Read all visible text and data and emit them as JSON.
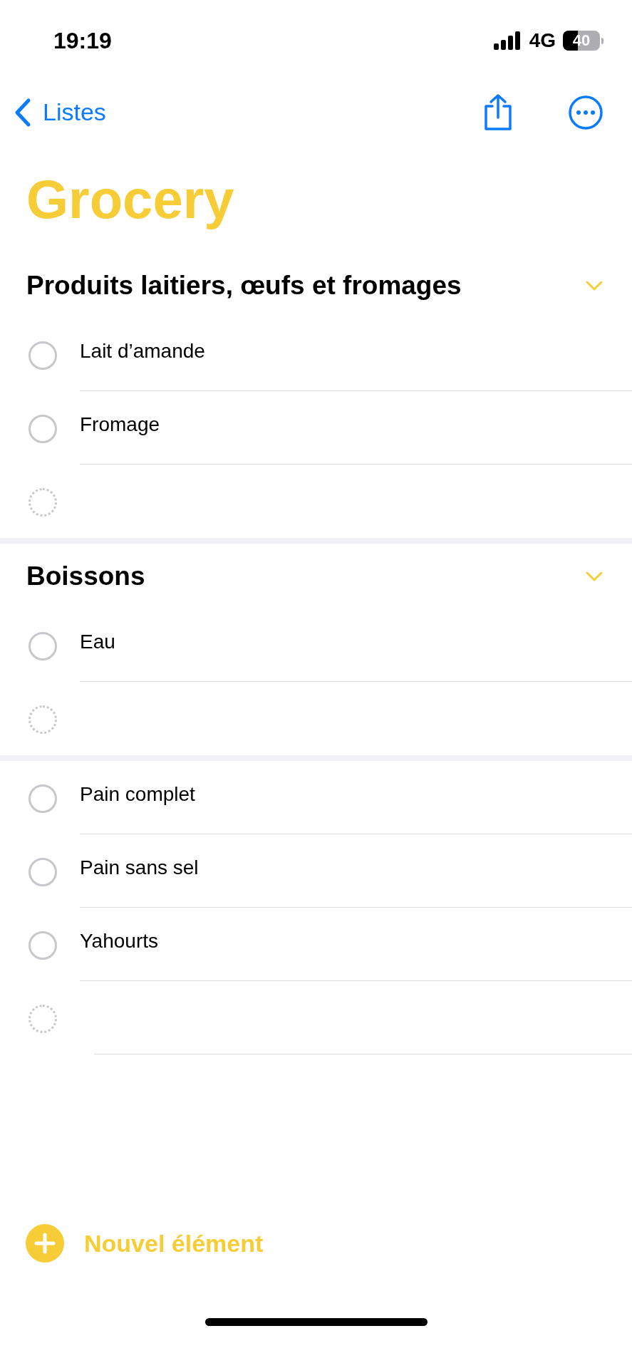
{
  "status_bar": {
    "time": "19:19",
    "network": "4G",
    "battery": "40"
  },
  "nav": {
    "back_label": "Listes"
  },
  "title": "Grocery",
  "sections": [
    {
      "title": "Produits laitiers, œufs et fromages",
      "expanded": true,
      "items": [
        {
          "kind": "task",
          "text": "Lait d’amande",
          "checked": false
        },
        {
          "kind": "task",
          "text": "Fromage",
          "checked": false
        },
        {
          "kind": "new"
        }
      ]
    },
    {
      "title": "Boissons",
      "expanded": true,
      "items": [
        {
          "kind": "task",
          "text": "Eau",
          "checked": false
        },
        {
          "kind": "new"
        }
      ]
    }
  ],
  "ungrouped": [
    {
      "kind": "task",
      "text": "Pain complet",
      "checked": false
    },
    {
      "kind": "task",
      "text": "Pain sans sel",
      "checked": false
    },
    {
      "kind": "task",
      "text": "Yahourts",
      "checked": false
    },
    {
      "kind": "new"
    }
  ],
  "new_item_button": {
    "label": "Nouvel élément"
  }
}
